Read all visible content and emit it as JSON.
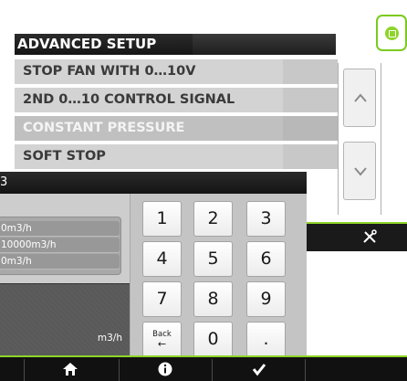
{
  "setup": {
    "title": "ADVANCED SETUP",
    "items": [
      {
        "label": "STOP FAN WITH 0…10V",
        "active": false
      },
      {
        "label": "2ND 0…10 CONTROL SIGNAL",
        "active": false
      },
      {
        "label": "CONSTANT PRESSURE",
        "active": true
      },
      {
        "label": "SOFT STOP",
        "active": false
      }
    ],
    "scroll_up_icon": "chevron-up-icon",
    "scroll_down_icon": "chevron-down-icon",
    "toolbar_icon": "tools-icon",
    "corner_icon": "status-led-icon"
  },
  "dialog": {
    "title": "3",
    "ranges": [
      "0m3/h",
      "10000m3/h",
      "0m3/h"
    ],
    "value": "",
    "unit": "m3/h",
    "keys": [
      "1",
      "2",
      "3",
      "4",
      "5",
      "6",
      "7",
      "8",
      "9",
      "Back",
      "0",
      "."
    ],
    "back_arrow": "←"
  },
  "bottom_bar": {
    "icons": [
      "home-icon",
      "info-icon",
      "checkmark-icon"
    ]
  },
  "colors": {
    "accent": "#8ed429",
    "bar": "#111111"
  }
}
